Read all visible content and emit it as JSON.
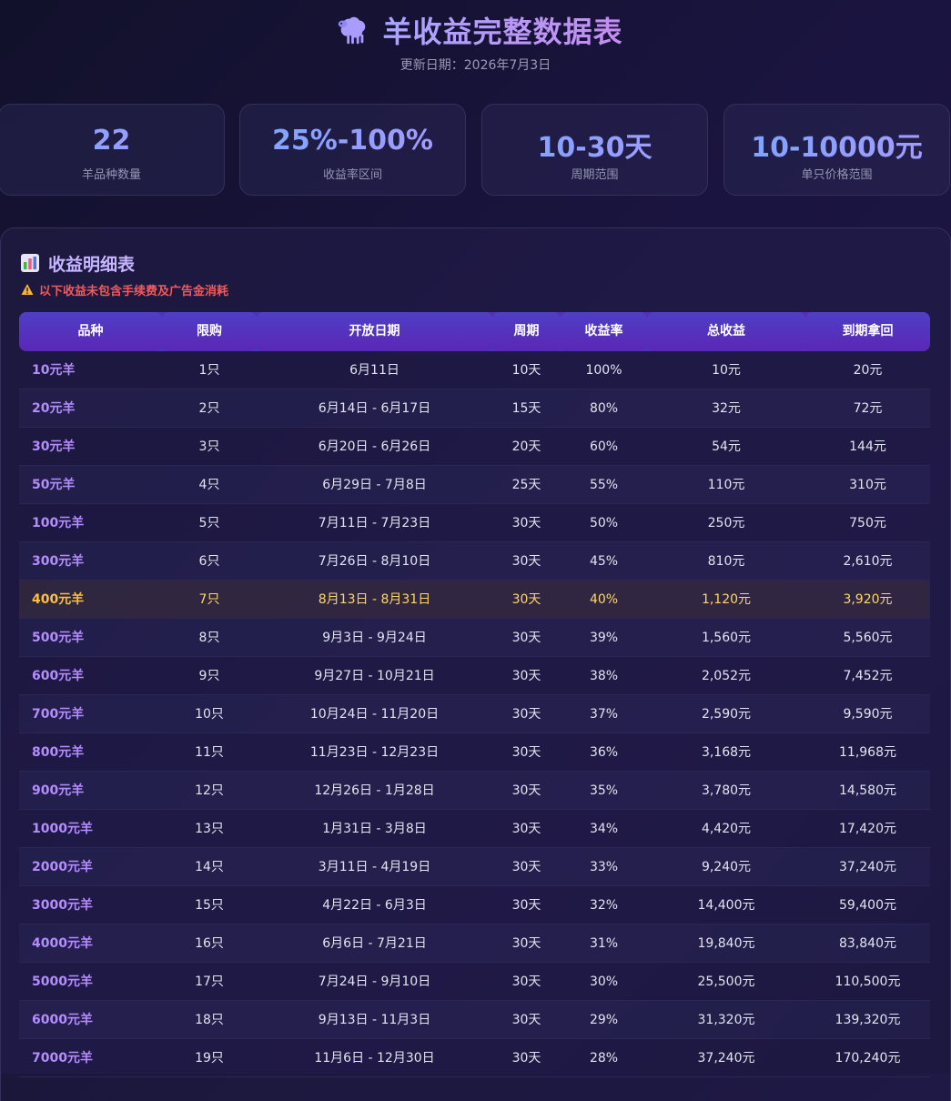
{
  "header": {
    "title": "羊收益完整数据表",
    "update_date": "更新日期：2026年7月3日"
  },
  "stats": [
    {
      "value": "22",
      "label": "羊品种数量"
    },
    {
      "value": "25%-100%",
      "label": "收益率区间"
    },
    {
      "value": "10-30天",
      "label": "周期范围"
    },
    {
      "value": "10-10000元",
      "label": "单只价格范围"
    }
  ],
  "panel": {
    "title": "收益明细表",
    "warning": "以下收益未包含手续费及广告金消耗"
  },
  "table": {
    "columns": [
      "品种",
      "限购",
      "开放日期",
      "周期",
      "收益率",
      "总收益",
      "到期拿回"
    ],
    "highlight_row_index": 6,
    "rows": [
      [
        "10元羊",
        "1只",
        "6月11日",
        "10天",
        "100%",
        "10元",
        "20元"
      ],
      [
        "20元羊",
        "2只",
        "6月14日 - 6月17日",
        "15天",
        "80%",
        "32元",
        "72元"
      ],
      [
        "30元羊",
        "3只",
        "6月20日 - 6月26日",
        "20天",
        "60%",
        "54元",
        "144元"
      ],
      [
        "50元羊",
        "4只",
        "6月29日 - 7月8日",
        "25天",
        "55%",
        "110元",
        "310元"
      ],
      [
        "100元羊",
        "5只",
        "7月11日 - 7月23日",
        "30天",
        "50%",
        "250元",
        "750元"
      ],
      [
        "300元羊",
        "6只",
        "7月26日 - 8月10日",
        "30天",
        "45%",
        "810元",
        "2,610元"
      ],
      [
        "400元羊",
        "7只",
        "8月13日 - 8月31日",
        "30天",
        "40%",
        "1,120元",
        "3,920元"
      ],
      [
        "500元羊",
        "8只",
        "9月3日 - 9月24日",
        "30天",
        "39%",
        "1,560元",
        "5,560元"
      ],
      [
        "600元羊",
        "9只",
        "9月27日 - 10月21日",
        "30天",
        "38%",
        "2,052元",
        "7,452元"
      ],
      [
        "700元羊",
        "10只",
        "10月24日 - 11月20日",
        "30天",
        "37%",
        "2,590元",
        "9,590元"
      ],
      [
        "800元羊",
        "11只",
        "11月23日 - 12月23日",
        "30天",
        "36%",
        "3,168元",
        "11,968元"
      ],
      [
        "900元羊",
        "12只",
        "12月26日 - 1月28日",
        "30天",
        "35%",
        "3,780元",
        "14,580元"
      ],
      [
        "1000元羊",
        "13只",
        "1月31日 - 3月8日",
        "30天",
        "34%",
        "4,420元",
        "17,420元"
      ],
      [
        "2000元羊",
        "14只",
        "3月11日 - 4月19日",
        "30天",
        "33%",
        "9,240元",
        "37,240元"
      ],
      [
        "3000元羊",
        "15只",
        "4月22日 - 6月3日",
        "30天",
        "32%",
        "14,400元",
        "59,400元"
      ],
      [
        "4000元羊",
        "16只",
        "6月6日 - 7月21日",
        "30天",
        "31%",
        "19,840元",
        "83,840元"
      ],
      [
        "5000元羊",
        "17只",
        "7月24日 - 9月10日",
        "30天",
        "30%",
        "25,500元",
        "110,500元"
      ],
      [
        "6000元羊",
        "18只",
        "9月13日 - 11月3日",
        "30天",
        "29%",
        "31,320元",
        "139,320元"
      ],
      [
        "7000元羊",
        "19只",
        "11月6日 - 12月30日",
        "30天",
        "28%",
        "37,240元",
        "170,240元"
      ]
    ]
  }
}
